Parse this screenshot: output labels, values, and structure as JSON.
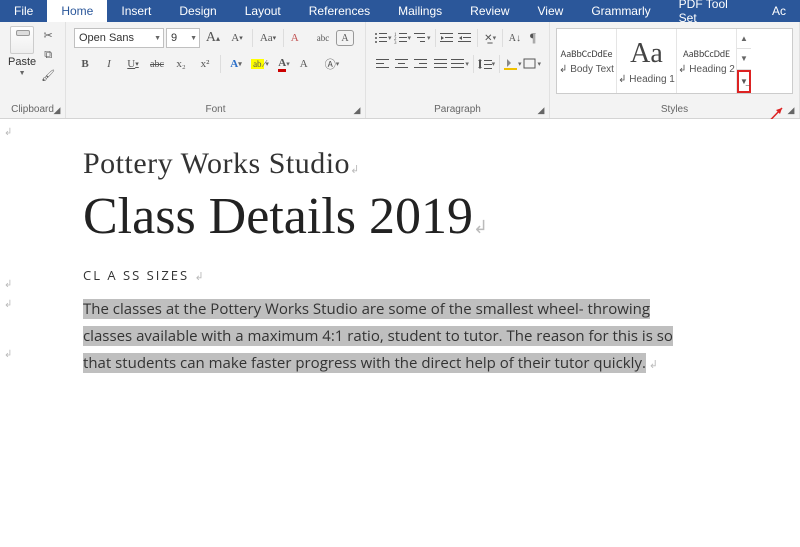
{
  "tabs": [
    "File",
    "Home",
    "Insert",
    "Design",
    "Layout",
    "References",
    "Mailings",
    "Review",
    "View",
    "Grammarly",
    "PDF Tool Set",
    "Ac"
  ],
  "activeTab": 1,
  "clipboard": {
    "paste": "Paste",
    "label": "Clipboard"
  },
  "font": {
    "name": "Open Sans",
    "size": "9",
    "buttons": {
      "bold": "B",
      "italic": "I",
      "underline": "U",
      "strike": "abc",
      "sub": "x₂",
      "sup": "x²"
    },
    "incA": "A",
    "decA": "A",
    "caseAa": "Aa",
    "clear": "A",
    "label": "Font"
  },
  "paragraph": {
    "label": "Paragraph"
  },
  "styles": {
    "label": "Styles",
    "items": [
      {
        "preview": "AaBbCcDdEe",
        "name": "↲ Body Text",
        "size": "10px",
        "weight": "400"
      },
      {
        "preview": "Aa",
        "name": "↲ Heading 1",
        "size": "28px",
        "weight": "400"
      },
      {
        "preview": "AaBbCcDdE",
        "name": "↲ Heading 2",
        "size": "10px",
        "weight": "400"
      }
    ]
  },
  "document": {
    "subtitle": "Pottery Works Studio",
    "title": "Class Details 2019",
    "heading": "CL A SS SIZES",
    "paragraph": "The classes at the Pottery Works Studio are some of the smallest wheel- throwing classes available with a maximum 4:1 ratio, student to tutor. The reason for this is so that students can make faster progress with the direct help of their tutor quickly."
  }
}
